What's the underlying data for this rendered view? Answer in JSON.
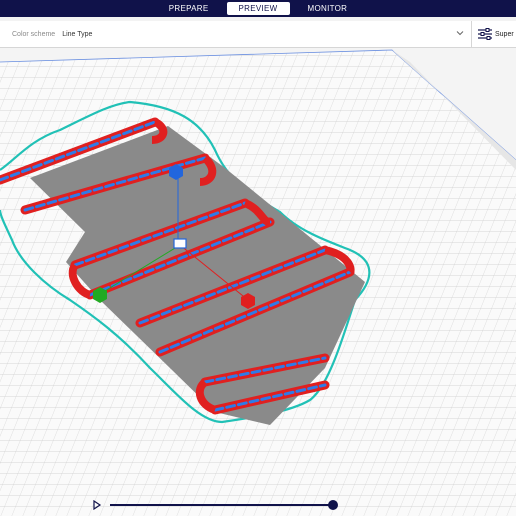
{
  "stages": [
    {
      "label": "PREPARE"
    },
    {
      "label": "PREVIEW"
    },
    {
      "label": "MONITOR"
    }
  ],
  "active_stage": "PREVIEW",
  "color_scheme": {
    "label": "Color scheme",
    "value": "Line Type"
  },
  "settings_panel": {
    "label": "Super"
  },
  "colors": {
    "stage_bar": "#10124a",
    "build_plate_grid": "#c8c8c8",
    "skirt": "#21c1b6",
    "outer_wall": "#e02020",
    "inner_wall": "#2e7be8",
    "model_base": "#8a8a8a",
    "axis_x": "#e02020",
    "axis_y": "#22aa22",
    "axis_z": "#2266dd"
  },
  "icons": [
    "chevron-down-icon",
    "sliders-icon",
    "play-icon"
  ]
}
